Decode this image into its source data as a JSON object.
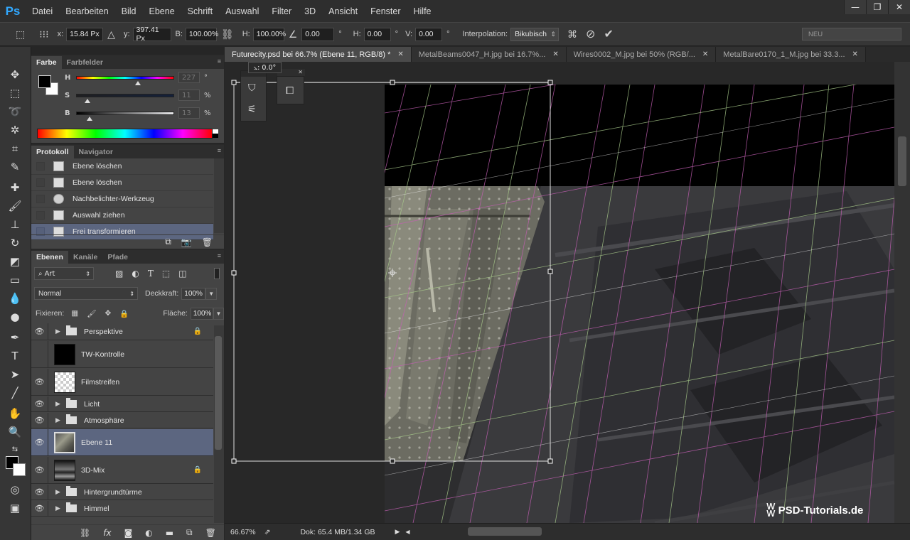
{
  "app": {
    "logo": "Ps"
  },
  "menu": [
    "Datei",
    "Bearbeiten",
    "Bild",
    "Ebene",
    "Schrift",
    "Auswahl",
    "Filter",
    "3D",
    "Ansicht",
    "Fenster",
    "Hilfe"
  ],
  "window_controls": {
    "minimize": "—",
    "restore": "❐",
    "close": "✕"
  },
  "options": {
    "x_label": "x:",
    "x_value": "15.84 Px",
    "y_label": "y:",
    "y_value": "397.41 Px",
    "w_label": "B:",
    "w_value": "100.00%",
    "h_label": "H:",
    "h_value": "100.00%",
    "rot_value": "0.00",
    "rot_unit": "°",
    "hskew_label": "H:",
    "hskew_value": "0.00",
    "hskew_unit": "°",
    "vskew_label": "V:",
    "vskew_value": "0.00",
    "vskew_unit": "°",
    "interp_label": "Interpolation:",
    "interp_value": "Bikubisch",
    "workspace": "NEU"
  },
  "color_panel": {
    "tabs": [
      "Farbe",
      "Farbfelder"
    ],
    "sliders": [
      {
        "letter": "H",
        "value": "227",
        "unit": "°",
        "level": 0.63
      },
      {
        "letter": "S",
        "value": "11",
        "unit": "%",
        "level": 0.11
      },
      {
        "letter": "B",
        "value": "13",
        "unit": "%",
        "level": 0.13
      }
    ]
  },
  "history_panel": {
    "tabs": [
      "Protokoll",
      "Navigator"
    ],
    "items": [
      {
        "label": "Ebene löschen",
        "icon": "doc-icon",
        "selected": false
      },
      {
        "label": "Ebene löschen",
        "icon": "doc-icon",
        "selected": false
      },
      {
        "label": "Nachbelichter-Werkzeug",
        "icon": "burn-tool-icon",
        "selected": false
      },
      {
        "label": "Auswahl ziehen",
        "icon": "doc-icon",
        "selected": false
      },
      {
        "label": "Frei transformieren",
        "icon": "doc-icon",
        "selected": true
      }
    ]
  },
  "layers_panel": {
    "tabs": [
      "Ebenen",
      "Kanäle",
      "Pfade"
    ],
    "filter": "Art",
    "blend_mode": "Normal",
    "opacity_label": "Deckkraft:",
    "opacity_value": "100%",
    "lock_label": "Fixieren:",
    "fill_label": "Fläche:",
    "fill_value": "100%",
    "layers": [
      {
        "name": "Perspektive",
        "type": "folder",
        "visible": true,
        "locked": true,
        "selected": false
      },
      {
        "name": "TW-Kontrolle",
        "type": "layer",
        "thumb": "black",
        "visible": false,
        "locked": false,
        "selected": false
      },
      {
        "name": "Filmstreifen",
        "type": "layer",
        "thumb": "transparent",
        "visible": true,
        "locked": false,
        "selected": false
      },
      {
        "name": "Licht",
        "type": "folder",
        "visible": true,
        "locked": false,
        "selected": false
      },
      {
        "name": "Atmosphäre",
        "type": "folder",
        "visible": true,
        "locked": false,
        "selected": false
      },
      {
        "name": "Ebene 11",
        "type": "layer",
        "thumb": "metal",
        "visible": true,
        "locked": false,
        "selected": true
      },
      {
        "name": "3D-Mix",
        "type": "layer",
        "thumb": "city",
        "visible": true,
        "locked": true,
        "selected": false
      },
      {
        "name": "Hintergrundtürme",
        "type": "folder",
        "visible": true,
        "locked": false,
        "selected": false
      },
      {
        "name": "Himmel",
        "type": "folder",
        "visible": true,
        "locked": false,
        "selected": false
      }
    ]
  },
  "documents": {
    "tabs": [
      {
        "label": "Futurecity.psd bei 66.7% (Ebene 11, RGB/8) *",
        "active": true
      },
      {
        "label": "MetalBeams0047_H.jpg bei 16.7%...",
        "active": false
      },
      {
        "label": "Wires0002_M.jpg bei 50% (RGB/...",
        "active": false
      },
      {
        "label": "MetalBare0170_1_M.jpg bei 33.3...",
        "active": false
      }
    ]
  },
  "transform_tip": "⦣: 0.0°",
  "status": {
    "zoom": "66.67%",
    "doc_size": "Dok: 65.4 MB/1.34 GB"
  },
  "watermark": "PSD-Tutorials.de",
  "colors": {
    "accent": "#31a8ff",
    "selection": "#5c6680",
    "panel": "#444444"
  }
}
